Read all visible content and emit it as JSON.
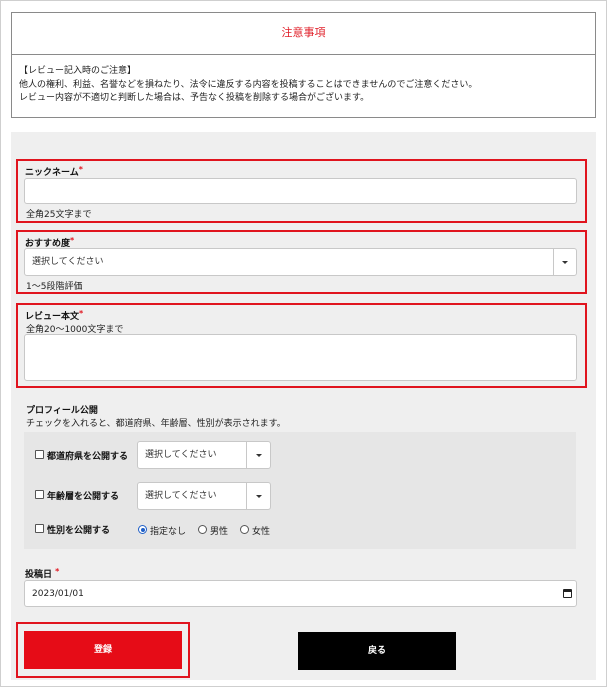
{
  "notice": {
    "title": "注意事項",
    "line1": "【レビュー記入時のご注意】",
    "line2": "他人の権利、利益、名誉などを損ねたり、法令に違反する内容を投稿することはできませんのでご注意ください。",
    "line3": "レビュー内容が不適切と判断した場合は、予告なく投稿を削除する場合がございます。"
  },
  "nickname": {
    "label": "ニックネーム",
    "required_mark": "*",
    "value": "",
    "hint": "全角25文字まで"
  },
  "recommend": {
    "label": "おすすめ度",
    "required_mark": "*",
    "selected": "選択してください",
    "hint": "1〜5段階評価"
  },
  "review": {
    "label": "レビュー本文",
    "required_mark": "*",
    "hint": "全角20〜1000文字まで",
    "value": ""
  },
  "profile": {
    "title": "プロフィール公開",
    "description": "チェックを入れると、都道府県、年齢層、性別が表示されます。",
    "prefecture": {
      "label": "都道府県を公開する",
      "checked": false,
      "selected": "選択してください"
    },
    "age": {
      "label": "年齢層を公開する",
      "checked": false,
      "selected": "選択してください"
    },
    "gender": {
      "label": "性別を公開する",
      "checked": false,
      "options": [
        "指定なし",
        "男性",
        "女性"
      ],
      "selected": "指定なし"
    }
  },
  "post_date": {
    "label": "投稿日",
    "required_mark": "*",
    "value": "2023/01/01"
  },
  "buttons": {
    "submit": "登録",
    "back": "戻る"
  },
  "colors": {
    "accent_red": "#e0141e",
    "submit_bg": "#e60c17",
    "back_bg": "#000000",
    "radio_selected": "#1f5fc7"
  }
}
